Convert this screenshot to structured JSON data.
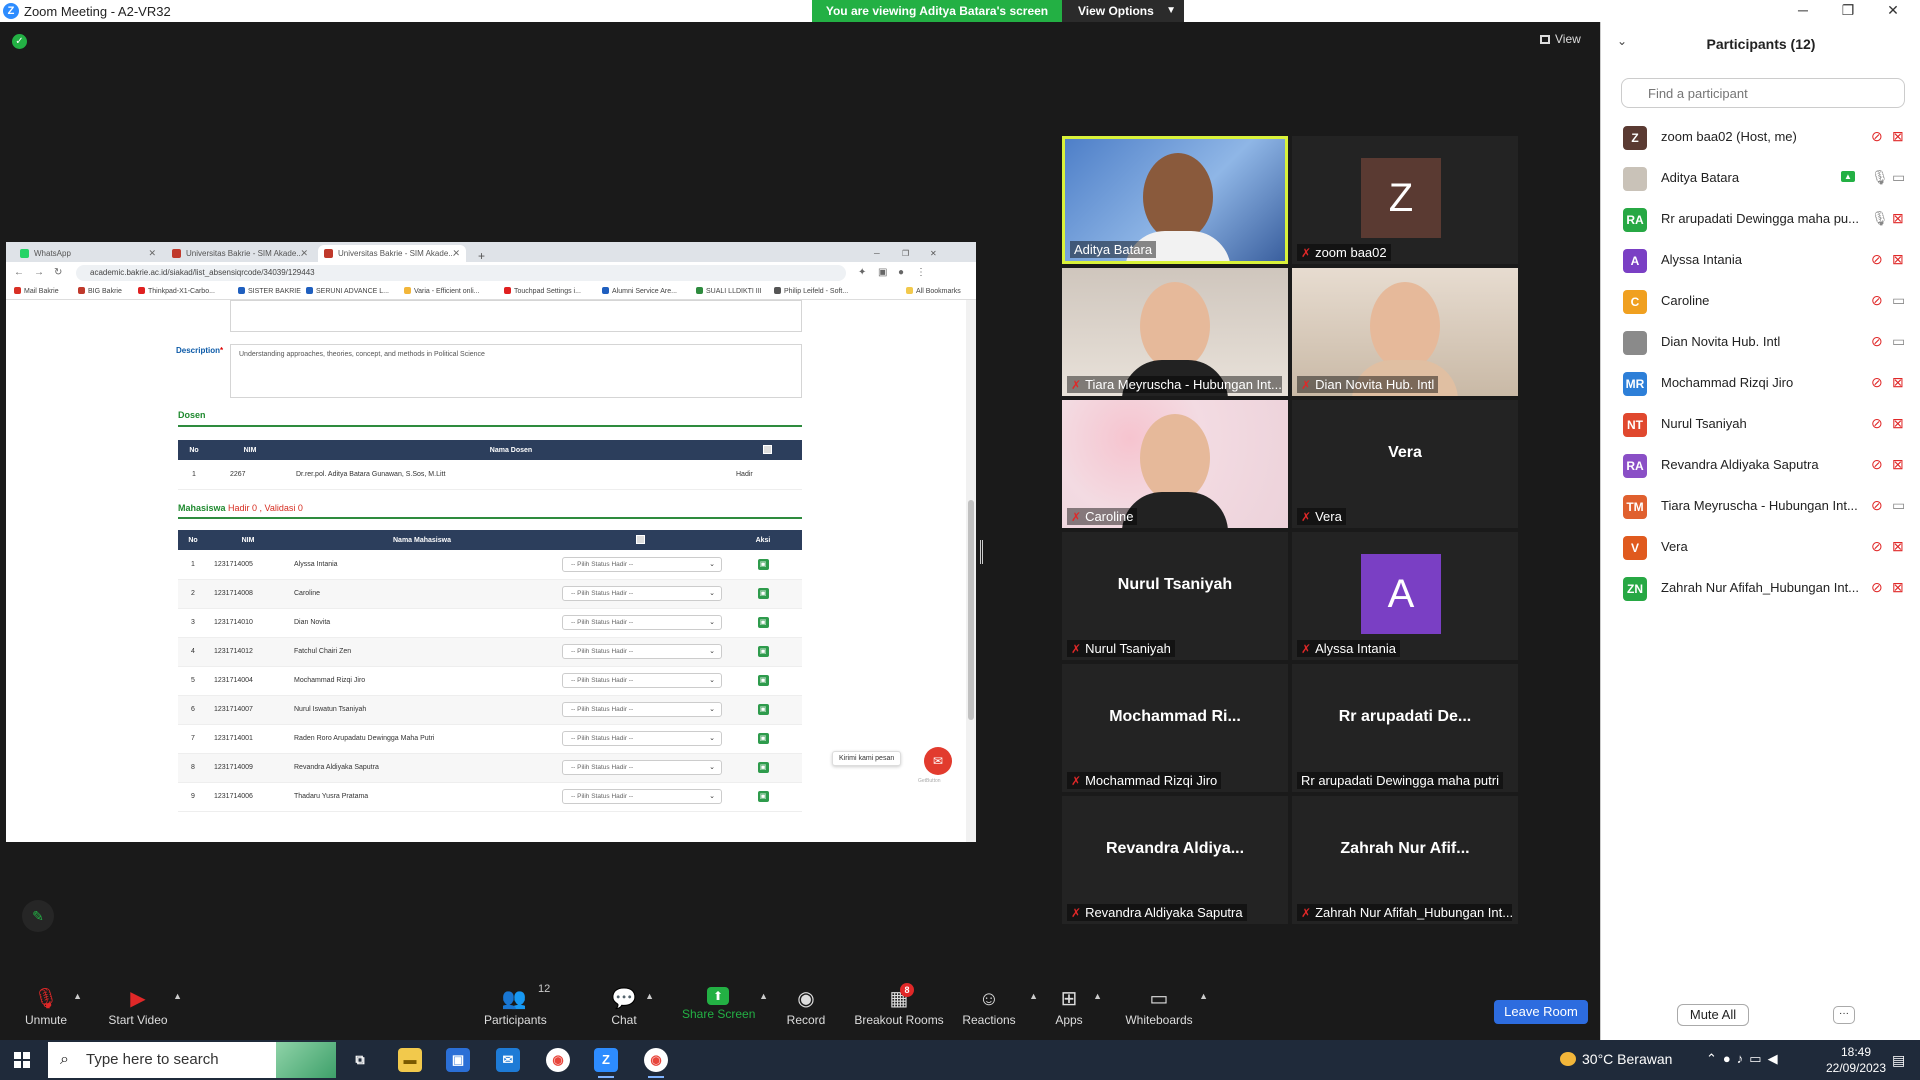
{
  "window": {
    "title": "Zoom Meeting - A2-VR32",
    "viewing_banner": "You are viewing Aditya Batara's screen",
    "view_options": "View Options",
    "view_button": "View"
  },
  "shared_screen": {
    "tabs": [
      "WhatsApp",
      "Universitas Bakrie - SIM Akade...",
      "Universitas Bakrie - SIM Akade..."
    ],
    "url": "academic.bakrie.ac.id/siakad/list_absensiqrcode/34039/129443",
    "bookmarks": [
      "Mail Bakrie",
      "BIG Bakrie",
      "Thinkpad-X1-Carbo...",
      "SISTER BAKRIE",
      "SERUNI ADVANCE L...",
      "Varia - Efficient onli...",
      "Touchpad Settings i...",
      "Alumni Service Are...",
      "SUALI LLDIKTI III",
      "Philip Leifeld - Soft...",
      "All Bookmarks"
    ],
    "description_label": "Description",
    "description_required": "*",
    "description_text": "Understanding approaches, theories, concept, and methods in Political Science",
    "dosen_title": "Dosen",
    "dosen_table": {
      "headers": [
        "No",
        "NIM",
        "Nama Dosen",
        "",
        ""
      ],
      "rows": [
        [
          "1",
          "2267",
          "Dr.rer.pol. Aditya Batara Gunawan, S.Sos, M.Litt",
          "",
          "Hadir"
        ]
      ]
    },
    "mahasiswa_label": "Mahasiswa",
    "hadir_text": "Hadir  0 , Validasi  0",
    "mahasiswa_table": {
      "headers": [
        "No",
        "NIM",
        "Nama Mahasiswa",
        "",
        "Aksi"
      ],
      "select_placeholder": "-- Pilih Status Hadir --",
      "rows": [
        [
          "1",
          "1231714005",
          "Alyssa Intania"
        ],
        [
          "2",
          "1231714008",
          "Caroline"
        ],
        [
          "3",
          "1231714010",
          "Dian Novita"
        ],
        [
          "4",
          "1231714012",
          "Fatchul Chairi Zen"
        ],
        [
          "5",
          "1231714004",
          "Mochammad Rizqi Jiro"
        ],
        [
          "6",
          "1231714007",
          "Nurul Iswatun Tsaniyah"
        ],
        [
          "7",
          "1231714001",
          "Raden Roro Arupadatu Dewingga Maha Putri"
        ],
        [
          "8",
          "1231714009",
          "Revandra Aldiyaka Saputra"
        ],
        [
          "9",
          "1231714006",
          "Thadaru Yusra Pratama"
        ]
      ]
    },
    "chat_widget_label": "Kirimi kami pesan",
    "chat_widget_powered": "GetButton"
  },
  "tiles": [
    {
      "name": "Aditya Batara",
      "muted": false,
      "speaking": true,
      "kind": "video"
    },
    {
      "name": "zoom baa02",
      "muted": true,
      "kind": "avatar",
      "letter": "Z",
      "color": "#5a3a32"
    },
    {
      "name": "Tiara Meyruscha - Hubungan Int...",
      "muted": true,
      "kind": "video"
    },
    {
      "name": "Dian Novita Hub. Intl",
      "muted": true,
      "kind": "video"
    },
    {
      "name": "Caroline",
      "muted": true,
      "kind": "video"
    },
    {
      "name": "Vera",
      "muted": true,
      "kind": "text",
      "big": "Vera"
    },
    {
      "name": "Nurul Tsaniyah",
      "muted": true,
      "kind": "text",
      "big": "Nurul Tsaniyah"
    },
    {
      "name": "Alyssa Intania",
      "muted": true,
      "kind": "avatar",
      "letter": "A",
      "color": "#7a3fc4"
    },
    {
      "name": "Mochammad Rizqi Jiro",
      "muted": true,
      "kind": "text",
      "big": "Mochammad  Ri..."
    },
    {
      "name": "Rr arupadati Dewingga maha putri",
      "muted": false,
      "kind": "text",
      "big": "Rr arupadati De..."
    },
    {
      "name": "Revandra Aldiyaka Saputra",
      "muted": true,
      "kind": "text",
      "big": "Revandra  Aldiya..."
    },
    {
      "name": "Zahrah Nur Afifah_Hubungan Int...",
      "muted": true,
      "kind": "text",
      "big": "Zahrah Nur Afif..."
    }
  ],
  "participants": {
    "title": "Participants (12)",
    "search_placeholder": "Find a participant",
    "list": [
      {
        "initials": "Z",
        "color": "#5a3a32",
        "name": "zoom baa02 (Host, me)",
        "mic": "off",
        "cam": "off"
      },
      {
        "initials": "",
        "color": "#c9c2b8",
        "name": "Aditya Batara",
        "mic": "on",
        "cam": "on",
        "sharing": true
      },
      {
        "initials": "RA",
        "color": "#27a844",
        "name": "Rr arupadati Dewingga maha pu...",
        "mic": "on",
        "cam": "off"
      },
      {
        "initials": "A",
        "color": "#7a3fc4",
        "name": "Alyssa Intania",
        "mic": "off",
        "cam": "off"
      },
      {
        "initials": "C",
        "color": "#f0a020",
        "name": "Caroline",
        "mic": "off",
        "cam": "on"
      },
      {
        "initials": "",
        "color": "#8a8a8a",
        "name": "Dian Novita Hub. Intl",
        "mic": "off",
        "cam": "on"
      },
      {
        "initials": "MR",
        "color": "#2d7fd8",
        "name": "Mochammad Rizqi Jiro",
        "mic": "off",
        "cam": "off"
      },
      {
        "initials": "NT",
        "color": "#e0482e",
        "name": "Nurul Tsaniyah",
        "mic": "off",
        "cam": "off"
      },
      {
        "initials": "RA",
        "color": "#8a4fc6",
        "name": "Revandra Aldiyaka Saputra",
        "mic": "off",
        "cam": "off"
      },
      {
        "initials": "TM",
        "color": "#e0602e",
        "name": "Tiara Meyruscha - Hubungan Int...",
        "mic": "off",
        "cam": "on"
      },
      {
        "initials": "V",
        "color": "#e05a1e",
        "name": "Vera",
        "mic": "off",
        "cam": "off"
      },
      {
        "initials": "ZN",
        "color": "#27a844",
        "name": "Zahrah Nur Afifah_Hubungan Int...",
        "mic": "off",
        "cam": "off"
      }
    ],
    "mute_all": "Mute All",
    "more": "···"
  },
  "toolbar": {
    "unmute": "Unmute",
    "start_video": "Start Video",
    "participants": "Participants",
    "participants_count": "12",
    "chat": "Chat",
    "share_screen": "Share Screen",
    "record": "Record",
    "breakout_rooms": "Breakout Rooms",
    "breakout_badge": "8",
    "reactions": "Reactions",
    "apps": "Apps",
    "whiteboards": "Whiteboards",
    "leave": "Leave Room"
  },
  "taskbar": {
    "search_placeholder": "Type here to search",
    "weather": "30°C  Berawan",
    "time": "18:49",
    "date": "22/09/2023"
  }
}
